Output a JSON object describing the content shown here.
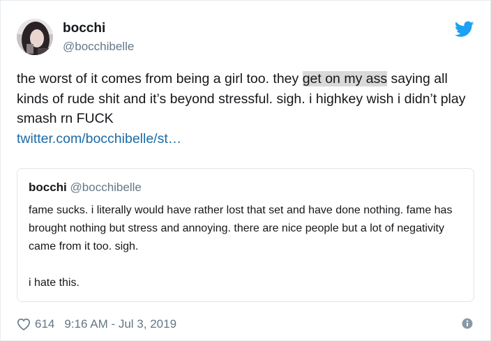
{
  "tweet": {
    "display_name": "bocchi",
    "handle": "@bocchibelle",
    "text_before_highlight": "the worst of it comes from being a girl too. they ",
    "text_highlight": "get on my ass",
    "text_after_highlight": " saying all kinds of rude shit and it’s beyond stressful. sigh. i highkey wish i didn’t play smash rn FUCK",
    "link": "twitter.com/bocchibelle/st…",
    "likes": "614",
    "timestamp": "9:16 AM - Jul 3, 2019"
  },
  "quoted_tweet": {
    "display_name": "bocchi",
    "handle": "@bocchibelle",
    "paragraph_1": "fame sucks. i literally would have rather lost that set and have done nothing. fame has brought nothing but stress and annoying. there are nice people but a lot of negativity came from it too. sigh.",
    "paragraph_2": "i hate this."
  },
  "icons": {
    "platform": "twitter-bird-icon",
    "like": "heart-icon",
    "info": "info-icon"
  },
  "colors": {
    "brand": "#1da1f2",
    "link": "#1b6aa5",
    "secondary_text": "#657786",
    "highlight": "#d9d9d9"
  }
}
